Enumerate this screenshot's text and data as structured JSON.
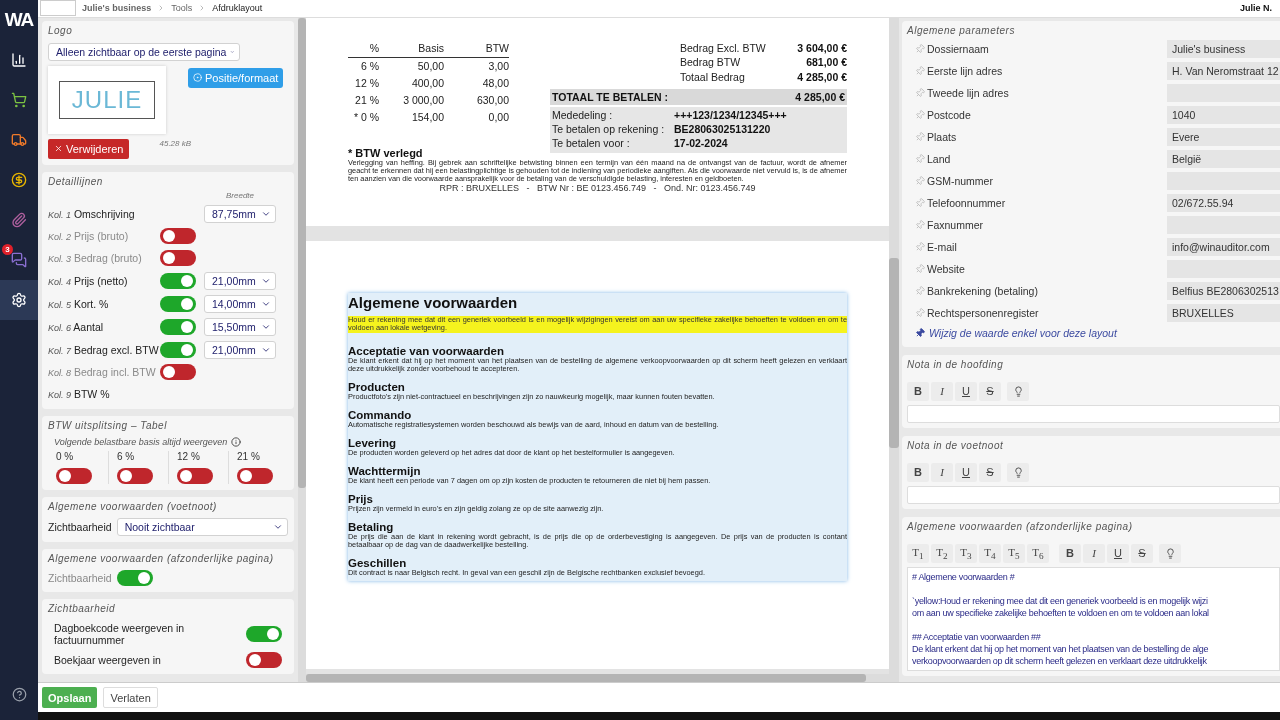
{
  "sidebar": {
    "logo": "WA",
    "items": [
      {
        "kind": "chart",
        "selected": false
      },
      {
        "kind": "cart",
        "selected": false
      },
      {
        "kind": "truck",
        "selected": false
      },
      {
        "kind": "money",
        "selected": false
      },
      {
        "kind": "paperclip",
        "selected": false
      },
      {
        "kind": "chat",
        "selected": false,
        "badge": "3"
      },
      {
        "kind": "settings",
        "selected": true
      }
    ]
  },
  "breadcrumb": [
    "Julie's business",
    "Tools",
    "Afdruklayout"
  ],
  "user": "Julie N.",
  "logo_card": {
    "title": "Logo",
    "visibility": "Alleen zichtbaar op de eerste pagina",
    "logo_text": "JULIE",
    "position_button": "Positie/formaat",
    "delete_button": "Verwijderen",
    "file_size": "45.28 kB"
  },
  "detail_lines": {
    "title": "Detaillijnen",
    "width_header": "Breedte",
    "columns": [
      {
        "kind": "fixed",
        "prefix": "Kol. 1",
        "label": "Omschrijving",
        "width": "87,75mm"
      },
      {
        "kind": "toggle",
        "prefix": "Kol. 2",
        "label": "Prijs (bruto)",
        "on": false
      },
      {
        "kind": "toggle",
        "prefix": "Kol. 3",
        "label": "Bedrag (bruto)",
        "on": false
      },
      {
        "kind": "toggle",
        "prefix": "Kol. 4",
        "label": "Prijs (netto)",
        "on": true,
        "width": "21,00mm"
      },
      {
        "kind": "toggle",
        "prefix": "Kol. 5",
        "label": "Kort. %",
        "on": true,
        "width": "14,00mm"
      },
      {
        "kind": "toggle",
        "prefix": "Kol. 6",
        "label": "Aantal",
        "on": true,
        "width": "15,50mm"
      },
      {
        "kind": "toggle",
        "prefix": "Kol. 7",
        "label": "Bedrag excl. BTW",
        "on": true,
        "width": "21,00mm"
      },
      {
        "kind": "toggle",
        "prefix": "Kol. 8",
        "label": "Bedrag incl. BTW",
        "on": false
      },
      {
        "kind": "plain",
        "prefix": "Kol. 9",
        "label": "BTW %"
      }
    ]
  },
  "vat_split": {
    "title": "BTW uitsplitsing – Tabel",
    "hint": "Volgende belastbare basis altijd weergeven",
    "rates": [
      {
        "label": "0 %",
        "on": false
      },
      {
        "label": "6 %",
        "on": false
      },
      {
        "label": "12 %",
        "on": false
      },
      {
        "label": "21 %",
        "on": false
      }
    ]
  },
  "terms_footnote": {
    "title": "Algemene voorwaarden (voetnoot)",
    "label": "Zichtbaarheid",
    "value": "Nooit zichtbaar"
  },
  "terms_page": {
    "title": "Algemene voorwaarden (afzonderlijke pagina)",
    "label": "Zichtbaarheid",
    "on": true
  },
  "visibility": {
    "title": "Zichtbaarheid",
    "items": [
      {
        "label": "Dagboekcode weergeven in factuurnummer",
        "on": true
      },
      {
        "label": "Boekjaar weergeven in",
        "on": false
      }
    ]
  },
  "footer_buttons": [
    "Opslaan",
    "Verlaten"
  ],
  "invoice": {
    "vat_columns": [
      "%",
      "Basis",
      "BTW"
    ],
    "vat_rows": [
      [
        "6 %",
        "50,00",
        "3,00"
      ],
      [
        "12 %",
        "400,00",
        "48,00"
      ],
      [
        "21 %",
        "3 000,00",
        "630,00"
      ],
      [
        "* 0 %",
        "154,00",
        "0,00"
      ]
    ],
    "totals": [
      {
        "label": "Bedrag Excl. BTW",
        "value": "3 604,00 €"
      },
      {
        "label": "Bedrag BTW",
        "value": "681,00 €"
      },
      {
        "label": "Totaal Bedrag",
        "value": "4 285,00 €"
      }
    ],
    "total_due": {
      "label": "TOTAAL TE BETALEN :",
      "value": "4 285,00 €"
    },
    "payment": [
      {
        "label": "Mededeling :",
        "value": "+++123/1234/12345+++"
      },
      {
        "label": "Te betalen op rekening :",
        "value": "BE28063025131220"
      },
      {
        "label": "Te betalen voor :",
        "value": "17-02-2024"
      }
    ],
    "reverse_charge_title": "* BTW verlegd",
    "reverse_charge_text": "Verlegging van heffing. Bij gebrek aan schriftelijke betwisting binnen een termijn van één maand na de ontvangst van de factuur, wordt de afnemer geacht te erkennen dat hij een belastingplichtige is gehouden tot de indiening van periodieke aangiften. Als die voorwaarde niet vervuld is, is de afnemer ten aanzien van die voorwaarde aansprakelijk voor de betaling van de verschuldigde belasting, interesten en geldboeten.",
    "footer": "RPR : BRUXELLES   -   BTW Nr : BE 0123.456.749   -   Ond. Nr: 0123.456.749"
  },
  "terms": {
    "title": "Algemene voorwaarden",
    "highlight": "Houd er rekening mee dat dit een generiek voorbeeld is en mogelijk wijzigingen vereist om aan uw specifieke zakelijke behoeften te voldoen en om te voldoen aan lokale wetgeving.",
    "sections": [
      {
        "heading": "Acceptatie van voorwaarden",
        "text": "De klant erkent dat hij op het moment van het plaatsen van de bestelling de algemene verkoopvoorwaarden op dit scherm heeft gelezen en verklaart deze uitdrukkelijk zonder voorbehoud te accepteren."
      },
      {
        "heading": "Producten",
        "text": "Productfoto's zijn niet-contractueel en beschrijvingen zijn zo nauwkeurig mogelijk, maar kunnen fouten bevatten."
      },
      {
        "heading": "Commando",
        "text": "Automatische registratiesystemen worden beschouwd als bewijs van de aard, inhoud en datum van de bestelling."
      },
      {
        "heading": "Levering",
        "text": "De producten worden geleverd op het adres dat door de klant op het bestelformulier is aangegeven."
      },
      {
        "heading": "Wachttermijn",
        "text": "De klant heeft een periode van 7 dagen om op zijn kosten de producten te retourneren die niet bij hem passen."
      },
      {
        "heading": "Prijs",
        "text": "Prijzen zijn vermeld in euro's en zijn geldig zolang ze op de site aanwezig zijn."
      },
      {
        "heading": "Betaling",
        "text": "De prijs die aan de klant in rekening wordt gebracht, is de prijs die op de orderbevestiging is aangegeven. De prijs van de producten is contant betaalbaar op de dag van de daadwerkelijke bestelling."
      },
      {
        "heading": "Geschillen",
        "text": "Dit contract is naar Belgisch recht. In geval van een geschil zijn de Belgische rechtbanken exclusief bevoegd."
      }
    ]
  },
  "general_params": {
    "title": "Algemene parameters",
    "fields": [
      {
        "label": "Dossiernaam",
        "value": "Julie's business"
      },
      {
        "label": "Eerste lijn adres",
        "value": "H. Van Neromstraat 12"
      },
      {
        "label": "Tweede lijn adres"
      },
      {
        "label": "Postcode",
        "value": "1040"
      },
      {
        "label": "Plaats",
        "value": "Evere"
      },
      {
        "label": "Land",
        "value": "België"
      },
      {
        "label": "GSM-nummer"
      },
      {
        "label": "Telefoonnummer",
        "value": "02/672.55.94"
      },
      {
        "label": "Faxnummer"
      },
      {
        "label": "E-mail",
        "value": "info@winauditor.com"
      },
      {
        "label": "Website"
      },
      {
        "label": "Bankrekening (betaling)",
        "value": "Belfius BE2806302513"
      },
      {
        "label": "Rechtspersonenregister",
        "value": "BRUXELLES"
      }
    ],
    "note": "Wijzig de waarde enkel voor deze layout"
  },
  "header_note": {
    "title": "Nota in de hoofding",
    "format_buttons": [
      {
        "kind": "bold",
        "label": "B"
      },
      {
        "kind": "italic",
        "label": "I"
      },
      {
        "kind": "underline",
        "label": "U"
      },
      {
        "kind": "strike",
        "label": "S"
      }
    ]
  },
  "footer_note": {
    "title": "Nota in de voetnoot",
    "format_buttons": [
      {
        "kind": "bold",
        "label": "B"
      },
      {
        "kind": "italic",
        "label": "I"
      },
      {
        "kind": "underline",
        "label": "U"
      },
      {
        "kind": "strike",
        "label": "S"
      }
    ]
  },
  "terms_editor": {
    "title": "Algemene voorwaarden (afzonderlijke pagina)",
    "heading_buttons": [
      "T$_{1}$",
      "T$_{2}$",
      "T$_{3}$",
      "T$_{4}$",
      "T$_{5}$",
      "T$_{6}$"
    ],
    "format_buttons": [
      {
        "kind": "bold",
        "label": "B"
      },
      {
        "kind": "italic",
        "label": "I"
      },
      {
        "kind": "underline",
        "label": "U"
      },
      {
        "kind": "strike",
        "label": "S"
      }
    ],
    "paragraphs": [
      [
        "# Algemene voorwaarden #"
      ],
      [
        "`yellow:Houd er rekening mee dat dit een generiek voorbeeld is en mogelijk wijzi",
        "om aan uw specifieke zakelijke behoeften te voldoen en om te voldoen aan lokal"
      ],
      [
        "## Acceptatie van voorwaarden ##",
        "De klant erkent dat hij op het moment van het plaatsen van de bestelling de alge",
        "verkoopvoorwaarden op dit scherm heeft gelezen en verklaart deze uitdrukkelijk"
      ]
    ]
  }
}
